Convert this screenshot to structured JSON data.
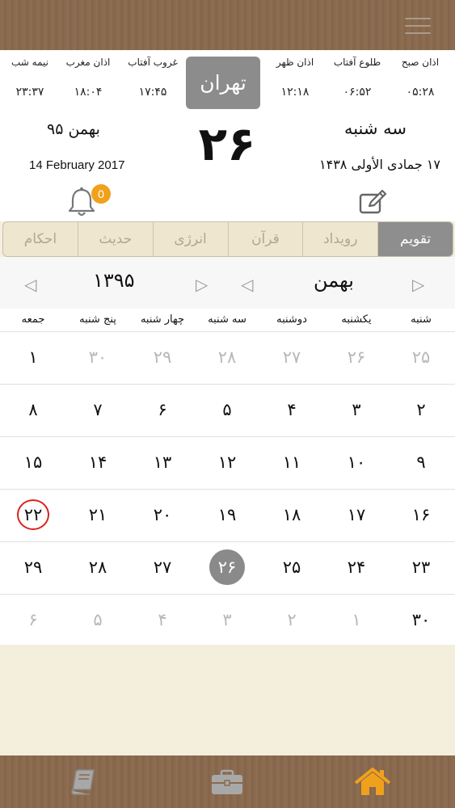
{
  "prayer_times": [
    {
      "name": "اذان صبح",
      "time": "۰۵:۲۸"
    },
    {
      "name": "طلوع آفتاب",
      "time": "۰۶:۵۲"
    },
    {
      "name": "اذان ظهر",
      "time": "۱۲:۱۸"
    },
    {
      "name": "غروب آفتاب",
      "time": "۱۷:۴۵"
    },
    {
      "name": "اذان مغرب",
      "time": "۱۸:۰۴"
    },
    {
      "name": "نیمه شب",
      "time": "۲۳:۳۷"
    }
  ],
  "city": "تهران",
  "today": {
    "day": "۲۶",
    "weekday": "سه شنبه",
    "persian_month_year": "بهمن ۹۵",
    "hijri": "۱۷ جمادی الأولی ۱۴۳۸",
    "gregorian": "14 February 2017",
    "notification_count": "0"
  },
  "tabs": [
    {
      "label": "تقویم",
      "active": true
    },
    {
      "label": "رویداد",
      "active": false
    },
    {
      "label": "قرآن",
      "active": false
    },
    {
      "label": "انرژی",
      "active": false
    },
    {
      "label": "حدیث",
      "active": false
    },
    {
      "label": "احکام",
      "active": false
    }
  ],
  "navigator": {
    "month": "بهمن",
    "year": "۱۳۹۵"
  },
  "weekdays": [
    "شنبه",
    "یکشنبه",
    "دوشنبه",
    "سه شنبه",
    "چهار شنبه",
    "پنج شنبه",
    "جمعه"
  ],
  "weeks": [
    [
      {
        "d": "۲۵",
        "m": true
      },
      {
        "d": "۲۶",
        "m": true
      },
      {
        "d": "۲۷",
        "m": true
      },
      {
        "d": "۲۸",
        "m": true
      },
      {
        "d": "۲۹",
        "m": true
      },
      {
        "d": "۳۰",
        "m": true
      },
      {
        "d": "۱"
      }
    ],
    [
      {
        "d": "۲"
      },
      {
        "d": "۳"
      },
      {
        "d": "۴"
      },
      {
        "d": "۵"
      },
      {
        "d": "۶"
      },
      {
        "d": "۷"
      },
      {
        "d": "۸"
      }
    ],
    [
      {
        "d": "۹"
      },
      {
        "d": "۱۰"
      },
      {
        "d": "۱۱"
      },
      {
        "d": "۱۲"
      },
      {
        "d": "۱۳"
      },
      {
        "d": "۱۴"
      },
      {
        "d": "۱۵"
      }
    ],
    [
      {
        "d": "۱۶"
      },
      {
        "d": "۱۷"
      },
      {
        "d": "۱۸"
      },
      {
        "d": "۱۹"
      },
      {
        "d": "۲۰"
      },
      {
        "d": "۲۱"
      },
      {
        "d": "۲۲",
        "marked": true
      }
    ],
    [
      {
        "d": "۲۳"
      },
      {
        "d": "۲۴"
      },
      {
        "d": "۲۵"
      },
      {
        "d": "۲۶",
        "today": true
      },
      {
        "d": "۲۷"
      },
      {
        "d": "۲۸"
      },
      {
        "d": "۲۹"
      }
    ],
    [
      {
        "d": "۳۰"
      },
      {
        "d": "۱",
        "m": true
      },
      {
        "d": "۲",
        "m": true
      },
      {
        "d": "۳",
        "m": true
      },
      {
        "d": "۴",
        "m": true
      },
      {
        "d": "۵",
        "m": true
      },
      {
        "d": "۶",
        "m": true
      }
    ]
  ],
  "icons": {
    "menu": "hamburger-menu-icon",
    "edit": "edit-note-icon",
    "bell": "bell-icon",
    "book": "book-icon",
    "briefcase": "briefcase-icon",
    "home": "home-icon"
  },
  "colors": {
    "accent": "#f0a11c",
    "marker": "#d8231b",
    "today": "#8a8a8a"
  }
}
